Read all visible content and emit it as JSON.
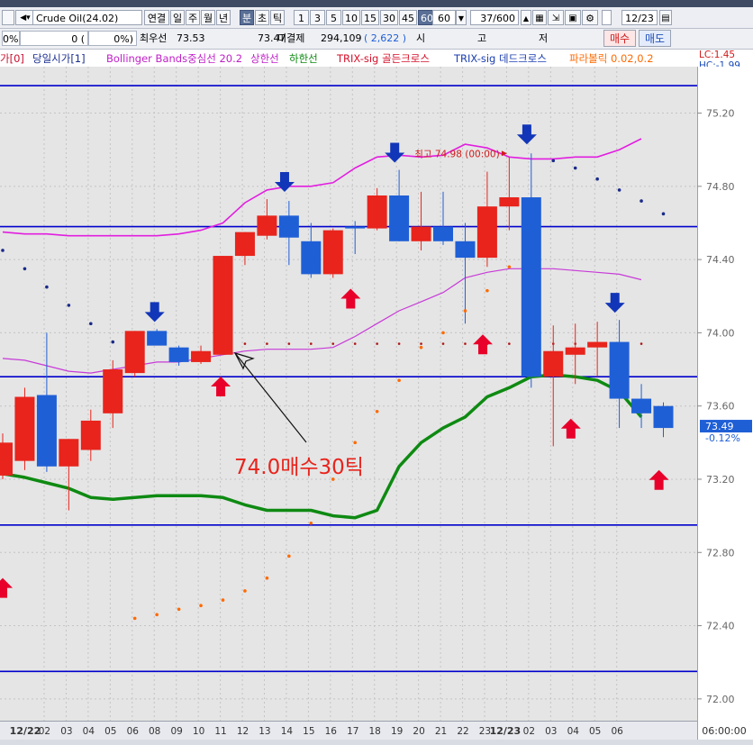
{
  "toolbar": {
    "symbol": "Crude Oil(24.02)",
    "period_buttons": [
      "연결",
      "일",
      "주",
      "월",
      "년",
      "분",
      "초",
      "틱"
    ],
    "minute_buttons": [
      "1",
      "3",
      "5",
      "10",
      "15",
      "30",
      "45",
      "60"
    ],
    "active_period": "분",
    "active_minute": "60",
    "interval_value": "60",
    "count_value": "37/600",
    "date_value": "12/23"
  },
  "inforow": {
    "col1": "0%",
    "col2": "0 (",
    "col3": "0%)",
    "best_bid_label": "최우선",
    "best_bid_value": "73.53",
    "best_ask_value": "73.47",
    "open_interest_label": "미결제",
    "open_interest_value": "294,109",
    "oi_change": "( 2,622 )",
    "price_label_1": "시",
    "price_label_2": "고",
    "price_label_3": "저",
    "buy_label": "매수",
    "sell_label": "매도"
  },
  "legend": {
    "item0": "가[0]",
    "item1": "당일시가[1]",
    "item2": "Bollinger Bands중심선 20.2",
    "item3": "상한선",
    "item4": "하한선",
    "item5": "TRIX-sig 골든크로스",
    "item6": "TRIX-sig 데드크로스",
    "item7": "파라볼릭 0.02,0.2",
    "lc": "LC:1.45",
    "hc": "HC:-1.99"
  },
  "colors": {
    "up": "#e8241c",
    "down": "#1f5fd6",
    "bb_band": "#e21ee0",
    "bb_mid": "#c83ad8",
    "lower_line": "#0e8a12",
    "level_line": "#0000cc",
    "sar": "#ff6a00",
    "sar_up": "#1a2a8a",
    "buy_arrow": "#e8002a",
    "sell_arrow": "#1236b8"
  },
  "chart_data": {
    "type": "candlestick",
    "ylim": [
      71.95,
      75.37
    ],
    "y_ticks": [
      "75.20",
      "74.80",
      "74.40",
      "74.00",
      "73.60",
      "73.20",
      "72.80",
      "72.40",
      "72.00"
    ],
    "x_labels": [
      "12/22",
      "02",
      "03",
      "04",
      "05",
      "06",
      "08",
      "09",
      "10",
      "11",
      "12",
      "13",
      "14",
      "15",
      "16",
      "17",
      "18",
      "19",
      "20",
      "21",
      "22",
      "23",
      "12/23",
      "02",
      "03",
      "04",
      "05",
      "06"
    ],
    "candles": [
      {
        "o": 73.22,
        "h": 73.45,
        "l": 73.2,
        "c": 73.4
      },
      {
        "o": 73.3,
        "h": 73.7,
        "l": 73.25,
        "c": 73.65
      },
      {
        "o": 73.66,
        "h": 74.0,
        "l": 73.24,
        "c": 73.27
      },
      {
        "o": 73.27,
        "h": 73.42,
        "l": 73.03,
        "c": 73.42
      },
      {
        "o": 73.36,
        "h": 73.58,
        "l": 73.3,
        "c": 73.52
      },
      {
        "o": 73.56,
        "h": 73.85,
        "l": 73.48,
        "c": 73.8
      },
      {
        "o": 73.78,
        "h": 74.01,
        "l": 73.76,
        "c": 74.01
      },
      {
        "o": 74.01,
        "h": 74.02,
        "l": 73.95,
        "c": 73.93
      },
      {
        "o": 73.92,
        "h": 73.93,
        "l": 73.82,
        "c": 73.84
      },
      {
        "o": 73.84,
        "h": 73.93,
        "l": 73.83,
        "c": 73.9
      },
      {
        "o": 73.88,
        "h": 74.42,
        "l": 73.88,
        "c": 74.42
      },
      {
        "o": 74.42,
        "h": 74.55,
        "l": 74.37,
        "c": 74.55
      },
      {
        "o": 74.53,
        "h": 74.73,
        "l": 74.51,
        "c": 74.64
      },
      {
        "o": 74.64,
        "h": 74.72,
        "l": 74.37,
        "c": 74.52
      },
      {
        "o": 74.5,
        "h": 74.6,
        "l": 74.3,
        "c": 74.32
      },
      {
        "o": 74.32,
        "h": 74.57,
        "l": 74.3,
        "c": 74.56
      },
      {
        "o": 74.58,
        "h": 74.61,
        "l": 74.43,
        "c": 74.57
      },
      {
        "o": 74.57,
        "h": 74.79,
        "l": 74.56,
        "c": 74.75
      },
      {
        "o": 74.75,
        "h": 74.89,
        "l": 74.5,
        "c": 74.5
      },
      {
        "o": 74.5,
        "h": 74.77,
        "l": 74.45,
        "c": 74.58
      },
      {
        "o": 74.58,
        "h": 74.77,
        "l": 74.48,
        "c": 74.5
      },
      {
        "o": 74.5,
        "h": 74.6,
        "l": 74.05,
        "c": 74.41
      },
      {
        "o": 74.41,
        "h": 74.88,
        "l": 74.36,
        "c": 74.69
      },
      {
        "o": 74.69,
        "h": 74.96,
        "l": 74.56,
        "c": 74.74
      },
      {
        "o": 74.74,
        "h": 74.98,
        "l": 73.7,
        "c": 73.76
      },
      {
        "o": 73.76,
        "h": 74.04,
        "l": 73.38,
        "c": 73.9
      },
      {
        "o": 73.88,
        "h": 74.05,
        "l": 73.72,
        "c": 73.92
      },
      {
        "o": 73.92,
        "h": 74.06,
        "l": 73.76,
        "c": 73.95
      },
      {
        "o": 73.95,
        "h": 74.07,
        "l": 73.48,
        "c": 73.64
      },
      {
        "o": 73.64,
        "h": 73.72,
        "l": 73.48,
        "c": 73.56
      },
      {
        "o": 73.6,
        "h": 73.62,
        "l": 73.43,
        "c": 73.48
      }
    ],
    "horizontal_levels": [
      75.35,
      74.58,
      73.76,
      72.95,
      72.15
    ],
    "bb_upper": [
      74.55,
      74.54,
      74.54,
      74.53,
      74.53,
      74.53,
      74.53,
      74.53,
      74.54,
      74.56,
      74.6,
      74.71,
      74.78,
      74.8,
      74.8,
      74.82,
      74.9,
      74.96,
      74.97,
      74.96,
      74.97,
      75.03,
      75.01,
      74.96,
      74.95,
      74.95,
      74.96,
      74.96,
      75.0,
      75.06
    ],
    "bb_mid": [
      73.86,
      73.85,
      73.82,
      73.79,
      73.78,
      73.8,
      73.82,
      73.84,
      73.84,
      73.86,
      73.88,
      73.9,
      73.91,
      73.91,
      73.91,
      73.92,
      73.98,
      74.05,
      74.12,
      74.17,
      74.22,
      74.3,
      74.33,
      74.35,
      74.35,
      74.35,
      74.34,
      74.33,
      74.32,
      74.29
    ],
    "lower_line": [
      73.23,
      73.21,
      73.18,
      73.15,
      73.1,
      73.09,
      73.1,
      73.11,
      73.11,
      73.11,
      73.1,
      73.06,
      73.03,
      73.03,
      73.03,
      73.0,
      72.99,
      73.03,
      73.27,
      73.4,
      73.48,
      73.54,
      73.65,
      73.7,
      73.76,
      73.77,
      73.76,
      73.74,
      73.68,
      73.54
    ],
    "sar": [
      72.44,
      72.46,
      72.49,
      72.51,
      72.54,
      72.59,
      72.66,
      72.78,
      72.96,
      73.2,
      73.4,
      73.57,
      73.74,
      73.92,
      74.0,
      74.12,
      74.23,
      74.36
    ],
    "sar_up": [
      74.94,
      74.9,
      74.84,
      74.78,
      74.72,
      74.65
    ],
    "high_annotation": "최고 74.98 (00:00)",
    "trade_note": "74.0매수30틱",
    "current_price": "73.49",
    "current_change": "-0.12%",
    "time_label": "06:00:00"
  }
}
